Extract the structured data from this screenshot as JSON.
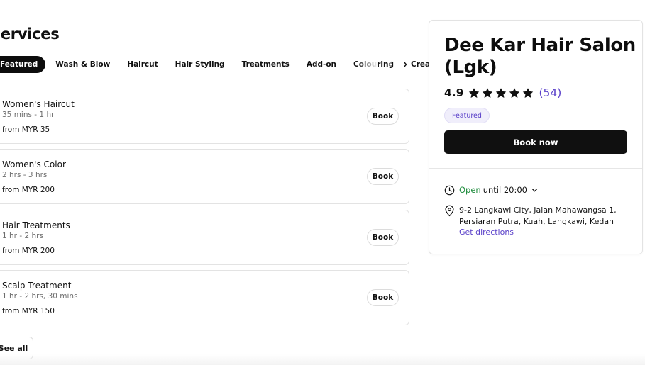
{
  "services": {
    "title": "Services",
    "tabs": [
      {
        "label": "Featured",
        "active": true
      },
      {
        "label": "Wash & Blow",
        "active": false
      },
      {
        "label": "Haircut",
        "active": false
      },
      {
        "label": "Hair Styling",
        "active": false
      },
      {
        "label": "Treatments",
        "active": false
      },
      {
        "label": "Add-on",
        "active": false
      },
      {
        "label": "Colouring",
        "active": false
      },
      {
        "label": "Creative Fo",
        "active": false
      }
    ],
    "items": [
      {
        "name": "Women's Haircut",
        "duration": "35 mins - 1 hr",
        "price": "from MYR 35",
        "book_label": "Book"
      },
      {
        "name": "Women's Color",
        "duration": "2 hrs - 3 hrs",
        "price": "from MYR 200",
        "book_label": "Book"
      },
      {
        "name": "Hair Treatments",
        "duration": "1 hr - 2 hrs",
        "price": "from MYR 200",
        "book_label": "Book"
      },
      {
        "name": "Scalp Treatment",
        "duration": "1 hr - 2 hrs, 30 mins",
        "price": "from MYR 150",
        "book_label": "Book"
      }
    ],
    "see_all_label": "See all"
  },
  "venue": {
    "name": "Dee Kar Hair Salon (Lgk)",
    "rating": "4.9",
    "stars": 5,
    "review_count": "(54)",
    "badge": "Featured",
    "book_now_label": "Book now",
    "hours": {
      "status": "Open",
      "until": "until 20:00"
    },
    "address": "9-2 Langkawi City, Jalan Mahawangsa 1, Persiaran Putra, Kuah, Langkawi, Kedah",
    "directions_label": "Get directions"
  },
  "icons": {
    "star": "star-icon",
    "clock": "clock-icon",
    "pin": "map-pin-icon",
    "chevron": "chevron-down-icon",
    "prev": "chevron-left-icon",
    "next": "chevron-right-icon"
  },
  "colors": {
    "accent": "#5a40c9",
    "open": "#1b8a3a",
    "primary_button": "#101010"
  }
}
